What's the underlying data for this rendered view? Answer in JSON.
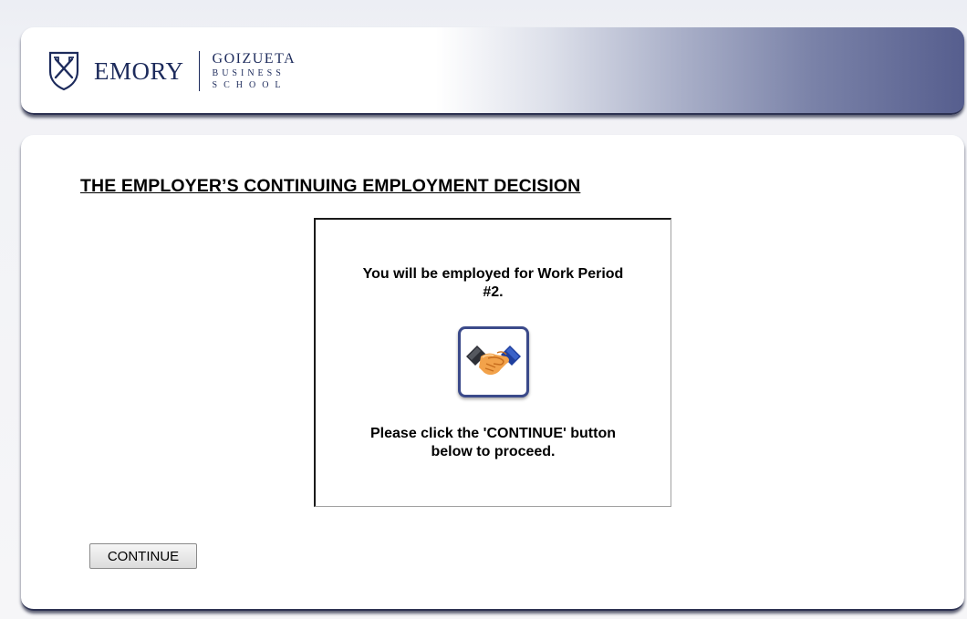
{
  "header": {
    "brand_name": "EMORY",
    "school_line1": "GOIZUETA",
    "school_line2": "BUSINESS",
    "school_line3": "SCHOOL",
    "logo_icon": "emory-shield-icon"
  },
  "main": {
    "title": "THE EMPLOYER’S CONTINUING EMPLOYMENT DECISION",
    "message": {
      "line1": "You will be employed for Work Period #2.",
      "icon": "handshake-icon",
      "line2": "Please click the 'CONTINUE' button below to proceed."
    },
    "continue_label": "CONTINUE"
  },
  "colors": {
    "brand_navy": "#1d2b5c",
    "header_gradient_end": "#565e8e",
    "icon_border": "#3b4a8a"
  }
}
